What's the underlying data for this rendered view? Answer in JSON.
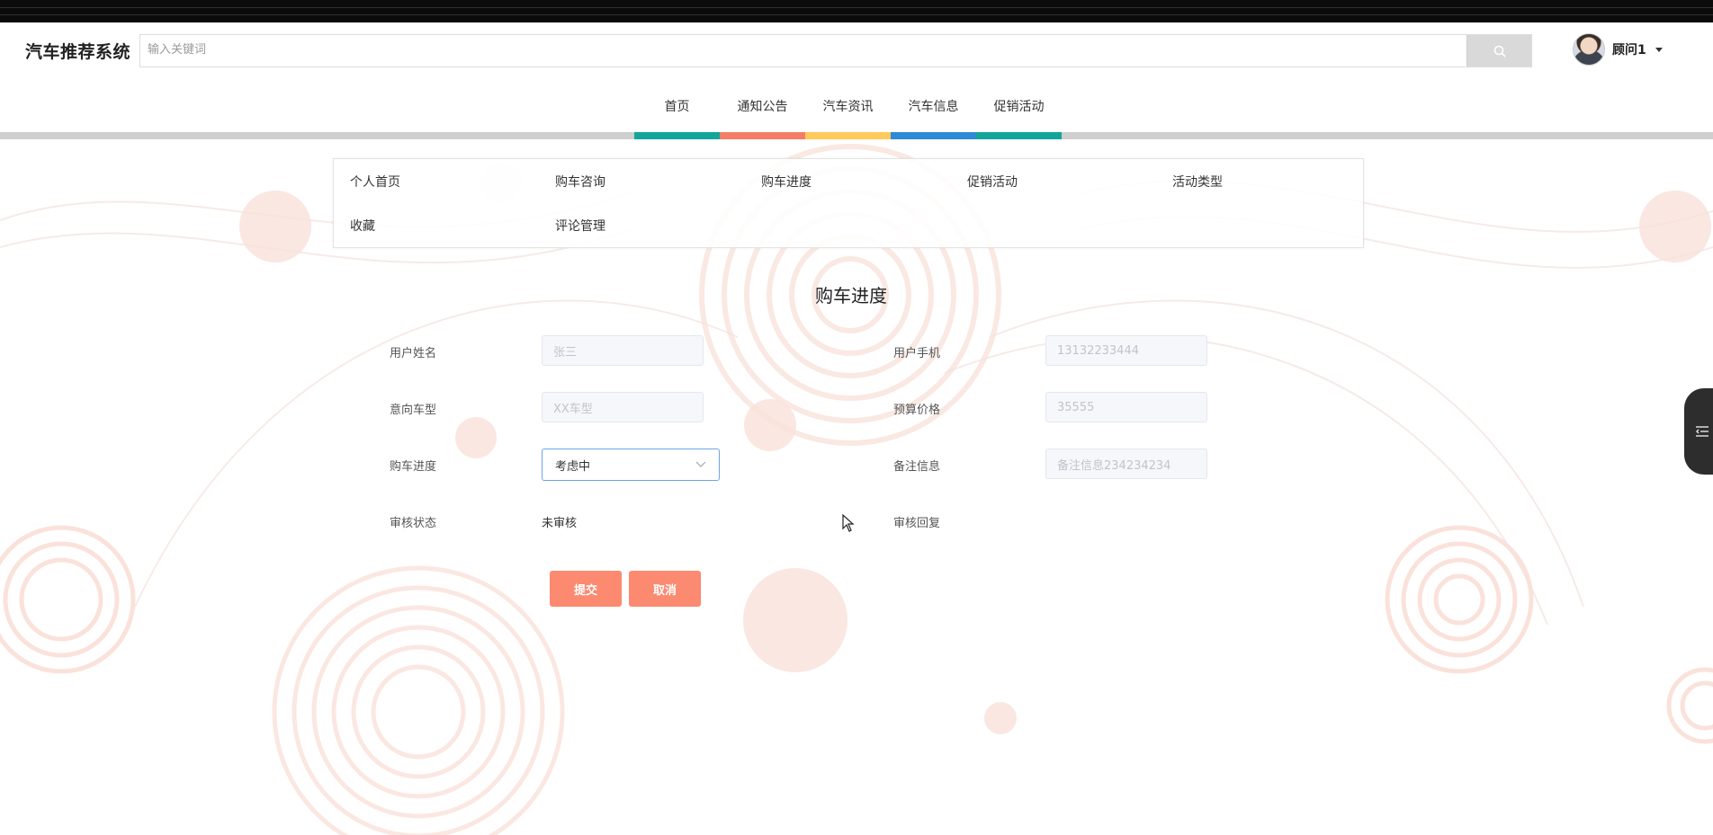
{
  "brand": "汽车推荐系统",
  "search": {
    "placeholder": "输入关键词"
  },
  "user": {
    "name": "顾问1"
  },
  "nav": {
    "items": [
      {
        "label": "首页",
        "color": "#14a59a"
      },
      {
        "label": "通知公告",
        "color": "#f47d68"
      },
      {
        "label": "汽车资讯",
        "color": "#ffc95c"
      },
      {
        "label": "汽车信息",
        "color": "#2d8ad8"
      },
      {
        "label": "促销活动",
        "color": "#14a59a"
      }
    ]
  },
  "menu": {
    "items": [
      "个人首页",
      "购车咨询",
      "购车进度",
      "促销活动",
      "活动类型",
      "收藏",
      "评论管理"
    ]
  },
  "page_title": "购车进度",
  "form": {
    "user_name": {
      "label": "用户姓名",
      "value": "张三"
    },
    "user_phone": {
      "label": "用户手机",
      "value": "13132233444"
    },
    "car_model": {
      "label": "意向车型",
      "value": "XX车型"
    },
    "budget": {
      "label": "预算价格",
      "value": "35555"
    },
    "progress": {
      "label": "购车进度",
      "value": "考虑中"
    },
    "remark": {
      "label": "备注信息",
      "value": "备注信息234234234"
    },
    "audit_status": {
      "label": "审核状态",
      "value": "未审核"
    },
    "audit_reply": {
      "label": "审核回复"
    }
  },
  "buttons": {
    "submit": "提交",
    "cancel": "取消"
  },
  "colors": {
    "accent": "#fb8a70",
    "select_border": "#6aa7e8"
  }
}
